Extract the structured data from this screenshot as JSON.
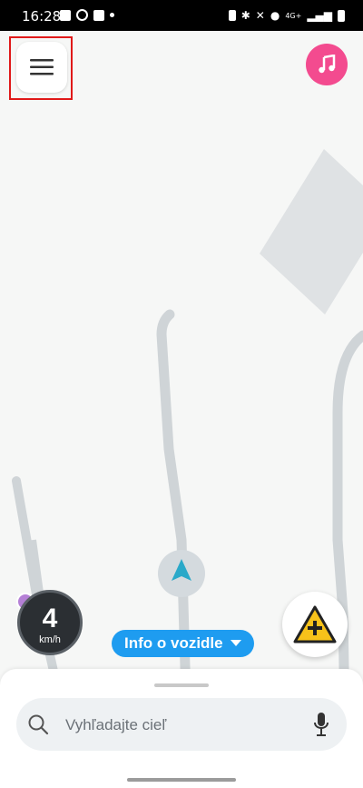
{
  "status_bar": {
    "time": "16:28",
    "network_label": "4G+"
  },
  "map": {
    "menu_icon": "hamburger-menu-icon",
    "music_icon": "music-note-icon",
    "report_icon": "hazard-report-icon",
    "colors": {
      "music": "#f34b8f",
      "vehicle_chip": "#1e9cf0",
      "position_arrow": "#2aa9c9",
      "report_triangle": "#f7c21a",
      "roads": "#cfd4d7"
    }
  },
  "speedometer": {
    "value": "4",
    "unit": "km/h"
  },
  "vehicle_info": {
    "label": "Info o vozidle"
  },
  "search": {
    "placeholder": "Vyhľadajte cieľ"
  }
}
